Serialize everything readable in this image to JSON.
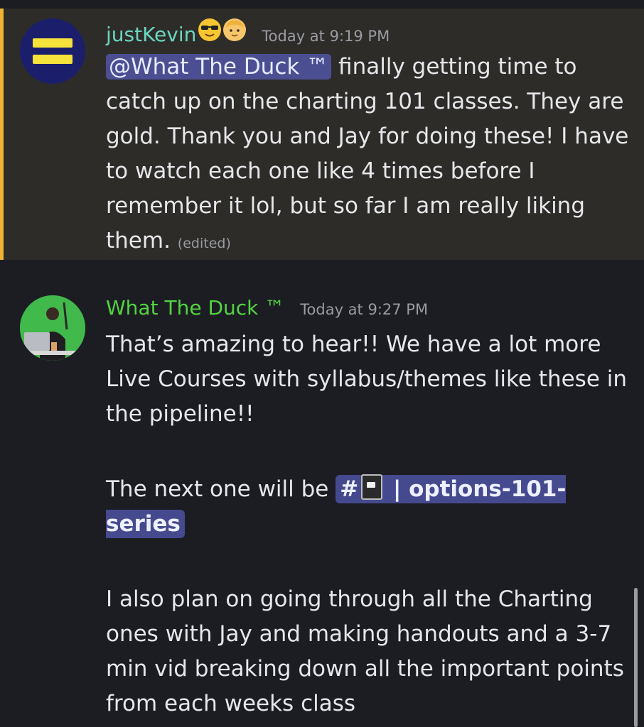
{
  "messages": [
    {
      "author": "justKevin",
      "author_color": "#6ad6c2",
      "author_emojis": [
        "smiling-face-with-sunglasses-icon",
        "boy-face-icon"
      ],
      "timestamp": "Today at 9:19 PM",
      "highlighted": true,
      "mention": "@What The Duck ™",
      "text": " finally getting time to catch up on the charting 101 classes. They are gold. Thank you and Jay for doing these! I have to watch each one like 4 times before I remember it lol, but so far I am really liking them.",
      "edited_label": "(edited)"
    },
    {
      "author": "What The Duck ™",
      "author_color": "#52d440",
      "timestamp": "Today at 9:27 PM",
      "highlighted": false,
      "paragraph1": "That’s amazing to hear!! We have a lot more Live Courses with syllabus/themes like these in the pipeline!!",
      "paragraph2_prefix": "The next one will be ",
      "channel_hash": "#",
      "channel_icon": "notebook-icon",
      "channel_name": " | options-101-series",
      "paragraph3": "I also plan on going through all the Charting ones with Jay and making handouts and a 3-7 min vid breaking down all the important points from each weeks class"
    }
  ],
  "colors": {
    "background": "#1c1d23",
    "mention_highlight_bg": "#2e2c28",
    "mention_bar": "#f0b232",
    "mention_pill": "#4b4f92",
    "channel_pill": "#454a8f",
    "timestamp": "#9a9ba3"
  }
}
